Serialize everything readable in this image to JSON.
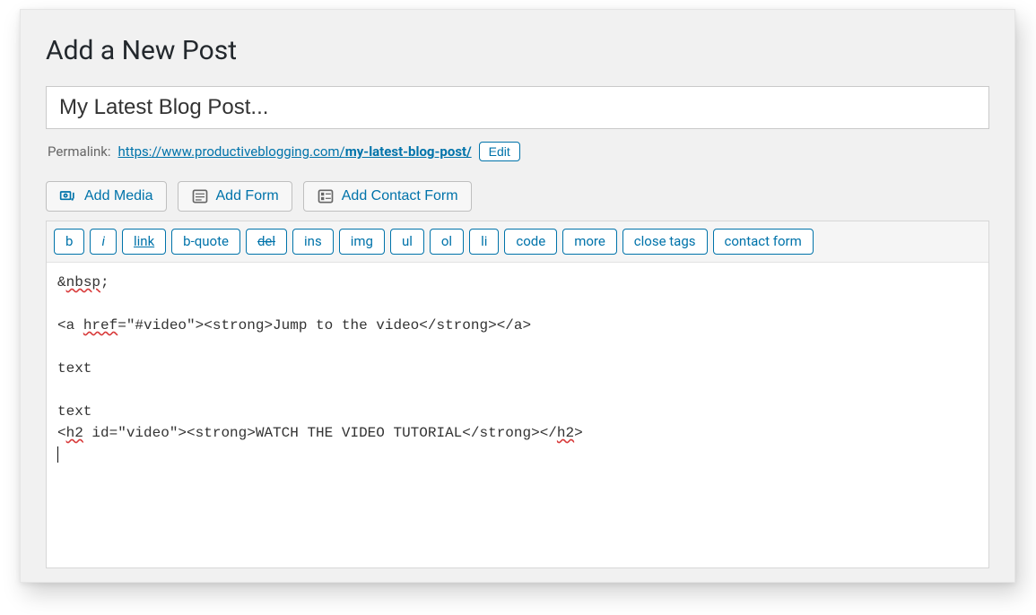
{
  "page": {
    "heading": "Add a New Post"
  },
  "title_input": {
    "value": "My Latest Blog Post..."
  },
  "permalink": {
    "label": "Permalink:",
    "base_url": "https://www.productiveblogging.com/",
    "slug": "my-latest-blog-post/",
    "edit_button": "Edit"
  },
  "media_buttons": {
    "add_media": "Add Media",
    "add_form": "Add Form",
    "add_contact_form": "Add Contact Form"
  },
  "quicktags": {
    "b": "b",
    "i": "i",
    "link": "link",
    "bquote": "b-quote",
    "del": "del",
    "ins": "ins",
    "img": "img",
    "ul": "ul",
    "ol": "ol",
    "li": "li",
    "code": "code",
    "more": "more",
    "close_tags": "close tags",
    "contact_form": "contact form"
  },
  "editor": {
    "l1a": "&",
    "l1b": "nbsp",
    "l1c": ";",
    "l2a": "<a ",
    "l2b": "href",
    "l2c": "=\"#video\"><strong>Jump to the video</strong></a>",
    "l3": "text",
    "l4": "text",
    "l5a": "<",
    "l5b": "h2",
    "l5c": " id=\"video\"><strong>WATCH THE VIDEO TUTORIAL</strong></",
    "l5d": "h2",
    "l5e": ">"
  }
}
